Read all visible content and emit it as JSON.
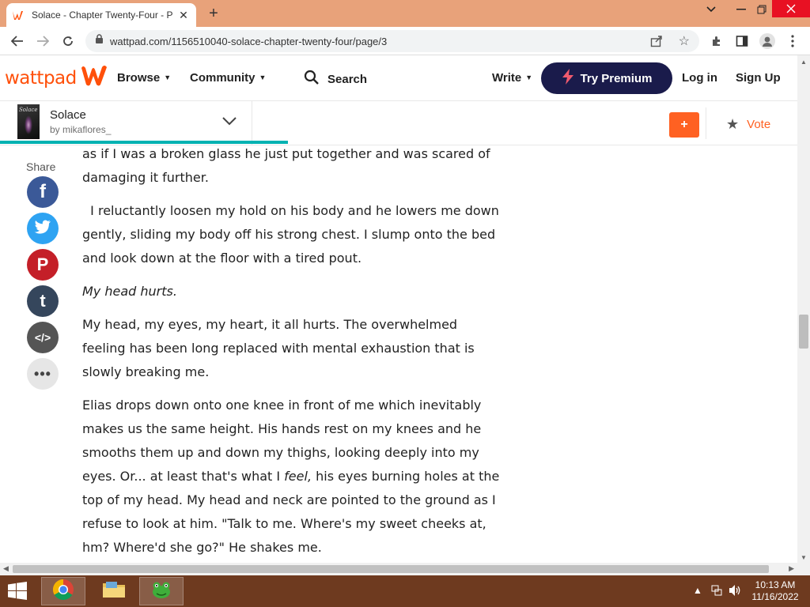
{
  "browser": {
    "tab_title": "Solace - Chapter Twenty-Four - P",
    "tab_close": "✕",
    "new_tab": "+",
    "url": "wattpad.com/1156510040-solace-chapter-twenty-four/page/3"
  },
  "header": {
    "logo_text": "wattpad",
    "nav": {
      "browse": "Browse",
      "community": "Community",
      "search": "Search",
      "write": "Write"
    },
    "premium_label": "Try Premium",
    "login": "Log in",
    "signup": "Sign Up"
  },
  "story": {
    "cover_title": "Solace",
    "title": "Solace",
    "byline": "by mikaflores_",
    "add_label": "+",
    "vote_label": "Vote",
    "progress": 0.355
  },
  "share": {
    "label": "Share",
    "items": [
      {
        "glyph": "f"
      },
      {
        "glyph": ""
      },
      {
        "glyph": "P"
      },
      {
        "glyph": "t"
      },
      {
        "glyph": "</>"
      },
      {
        "glyph": "•••"
      }
    ]
  },
  "content": {
    "paragraphs": [
      "as if I was a broken glass he just put together and was scared of damaging it further.",
      "  I reluctantly loosen my hold on his body and he lowers me down gently, sliding my body off his strong chest. I slump onto the bed and look down at the floor with a tired pout.",
      "My head hurts.",
      "My head, my eyes, my heart, it all hurts. The overwhelmed feeling has been long replaced with mental exhaustion that is slowly breaking me."
    ],
    "p5": {
      "a": "Elias drops down onto one knee in front of me which inevitably makes us the same height. His hands rest on my knees and he smooths them up and down my thighs, looking deeply into my eyes. Or... at least that's what I ",
      "b": "feel,",
      "c": " his eyes burning holes at the top of my head. My head and neck are pointed to the ground as I refuse to look at him. \"Talk to me. Where's my sweet cheeks at, hm? Where'd she go?\" He shakes me."
    }
  },
  "scroll": {
    "vertical_position": 0.55,
    "vertical_visible": 0.07,
    "horizontal_visible": 0.98
  },
  "taskbar": {
    "time": "10:13 AM",
    "date": "11/16/2022"
  },
  "colors": {
    "brand": "#ff500a",
    "premium_bg": "#1a1b4b",
    "progress": "#00b2b2",
    "tab_bar": "#e8a27a",
    "taskbar": "#6e3a1f"
  }
}
